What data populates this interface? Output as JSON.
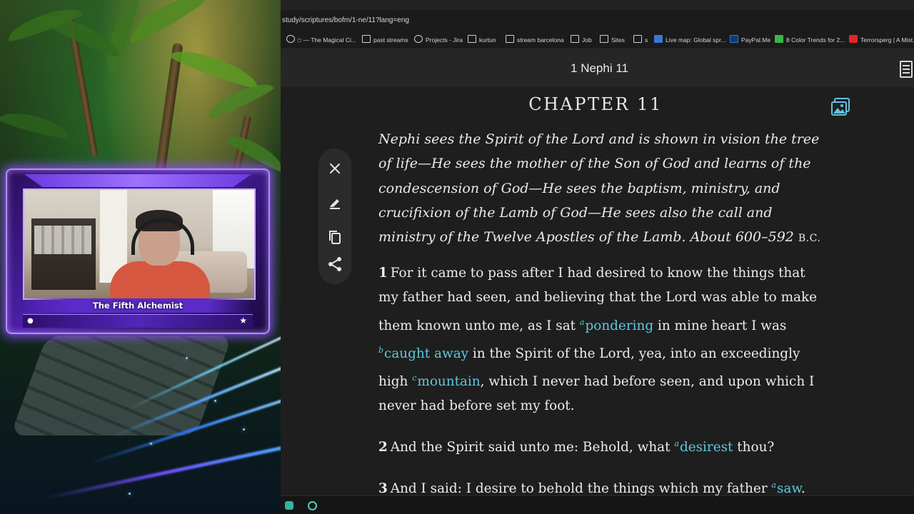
{
  "stream": {
    "streamer_name": "The Fifth Alchemist",
    "user_icon": "user-icon",
    "star_icon": "star-icon"
  },
  "browser": {
    "url": "study/scriptures/bofm/1-ne/11?lang=eng",
    "bookmarks": [
      {
        "label": "□ — The Magical Ci...",
        "icon": "tab-icon"
      },
      {
        "label": "past streams",
        "icon": "folder-icon"
      },
      {
        "label": "Projects - Jira",
        "icon": "globe-icon"
      },
      {
        "label": "kurtun",
        "icon": "folder-icon"
      },
      {
        "label": "stream barcelona",
        "icon": "folder-icon"
      },
      {
        "label": "Job",
        "icon": "folder-icon"
      },
      {
        "label": "Sites",
        "icon": "folder-icon"
      },
      {
        "label": "s",
        "icon": "folder-icon"
      },
      {
        "label": "Live map: Global spr...",
        "icon": "map-icon"
      },
      {
        "label": "PayPal.Me",
        "icon": "paypal-icon"
      },
      {
        "label": "8 Color Trends for 2...",
        "icon": "trend-icon"
      },
      {
        "label": "Terrorsperg | A Mist...",
        "icon": "youtube-icon"
      }
    ]
  },
  "reader": {
    "book_title": "1 Nephi 11",
    "chapter_title": "CHAPTER 11",
    "summary": "Nephi sees the Spirit of the Lord and is shown in vision the tree of life—He sees the mother of the Son of God and learns of the condescension of God—He sees the baptism, ministry, and crucifixion of the Lamb of God—He sees also the call and ministry of the Twelve Apostles of the Lamb. About 600–592",
    "summary_era": "B.C.",
    "verses": [
      {
        "num": "1",
        "parts": [
          {
            "t": "For it came to pass after I had desired to know the things that my father had seen, and believing that the Lord was able to make them known unto me, as I sat "
          },
          {
            "fn": "a",
            "t": "pondering"
          },
          {
            "t": " in mine heart I was "
          },
          {
            "fn": "b",
            "t": "caught away"
          },
          {
            "t": " in the Spirit of the Lord, yea, into an exceedingly high "
          },
          {
            "fn": "c",
            "t": "mountain"
          },
          {
            "t": ", which I never had before seen, and upon which I never had before set my foot."
          }
        ]
      },
      {
        "num": "2",
        "parts": [
          {
            "t": "And the Spirit said unto me: Behold, what "
          },
          {
            "fn": "a",
            "t": "desirest"
          },
          {
            "t": " thou?"
          }
        ]
      },
      {
        "num": "3",
        "parts": [
          {
            "t": "And I said: I desire to behold the things which my father "
          },
          {
            "fn": "a",
            "t": "saw"
          },
          {
            "t": "."
          }
        ]
      }
    ],
    "toolbar": [
      "close-icon",
      "highlight-icon",
      "copy-icon",
      "share-icon"
    ]
  },
  "colors": {
    "link": "#5ec8dd",
    "frame_glow": "#8c50ff"
  }
}
